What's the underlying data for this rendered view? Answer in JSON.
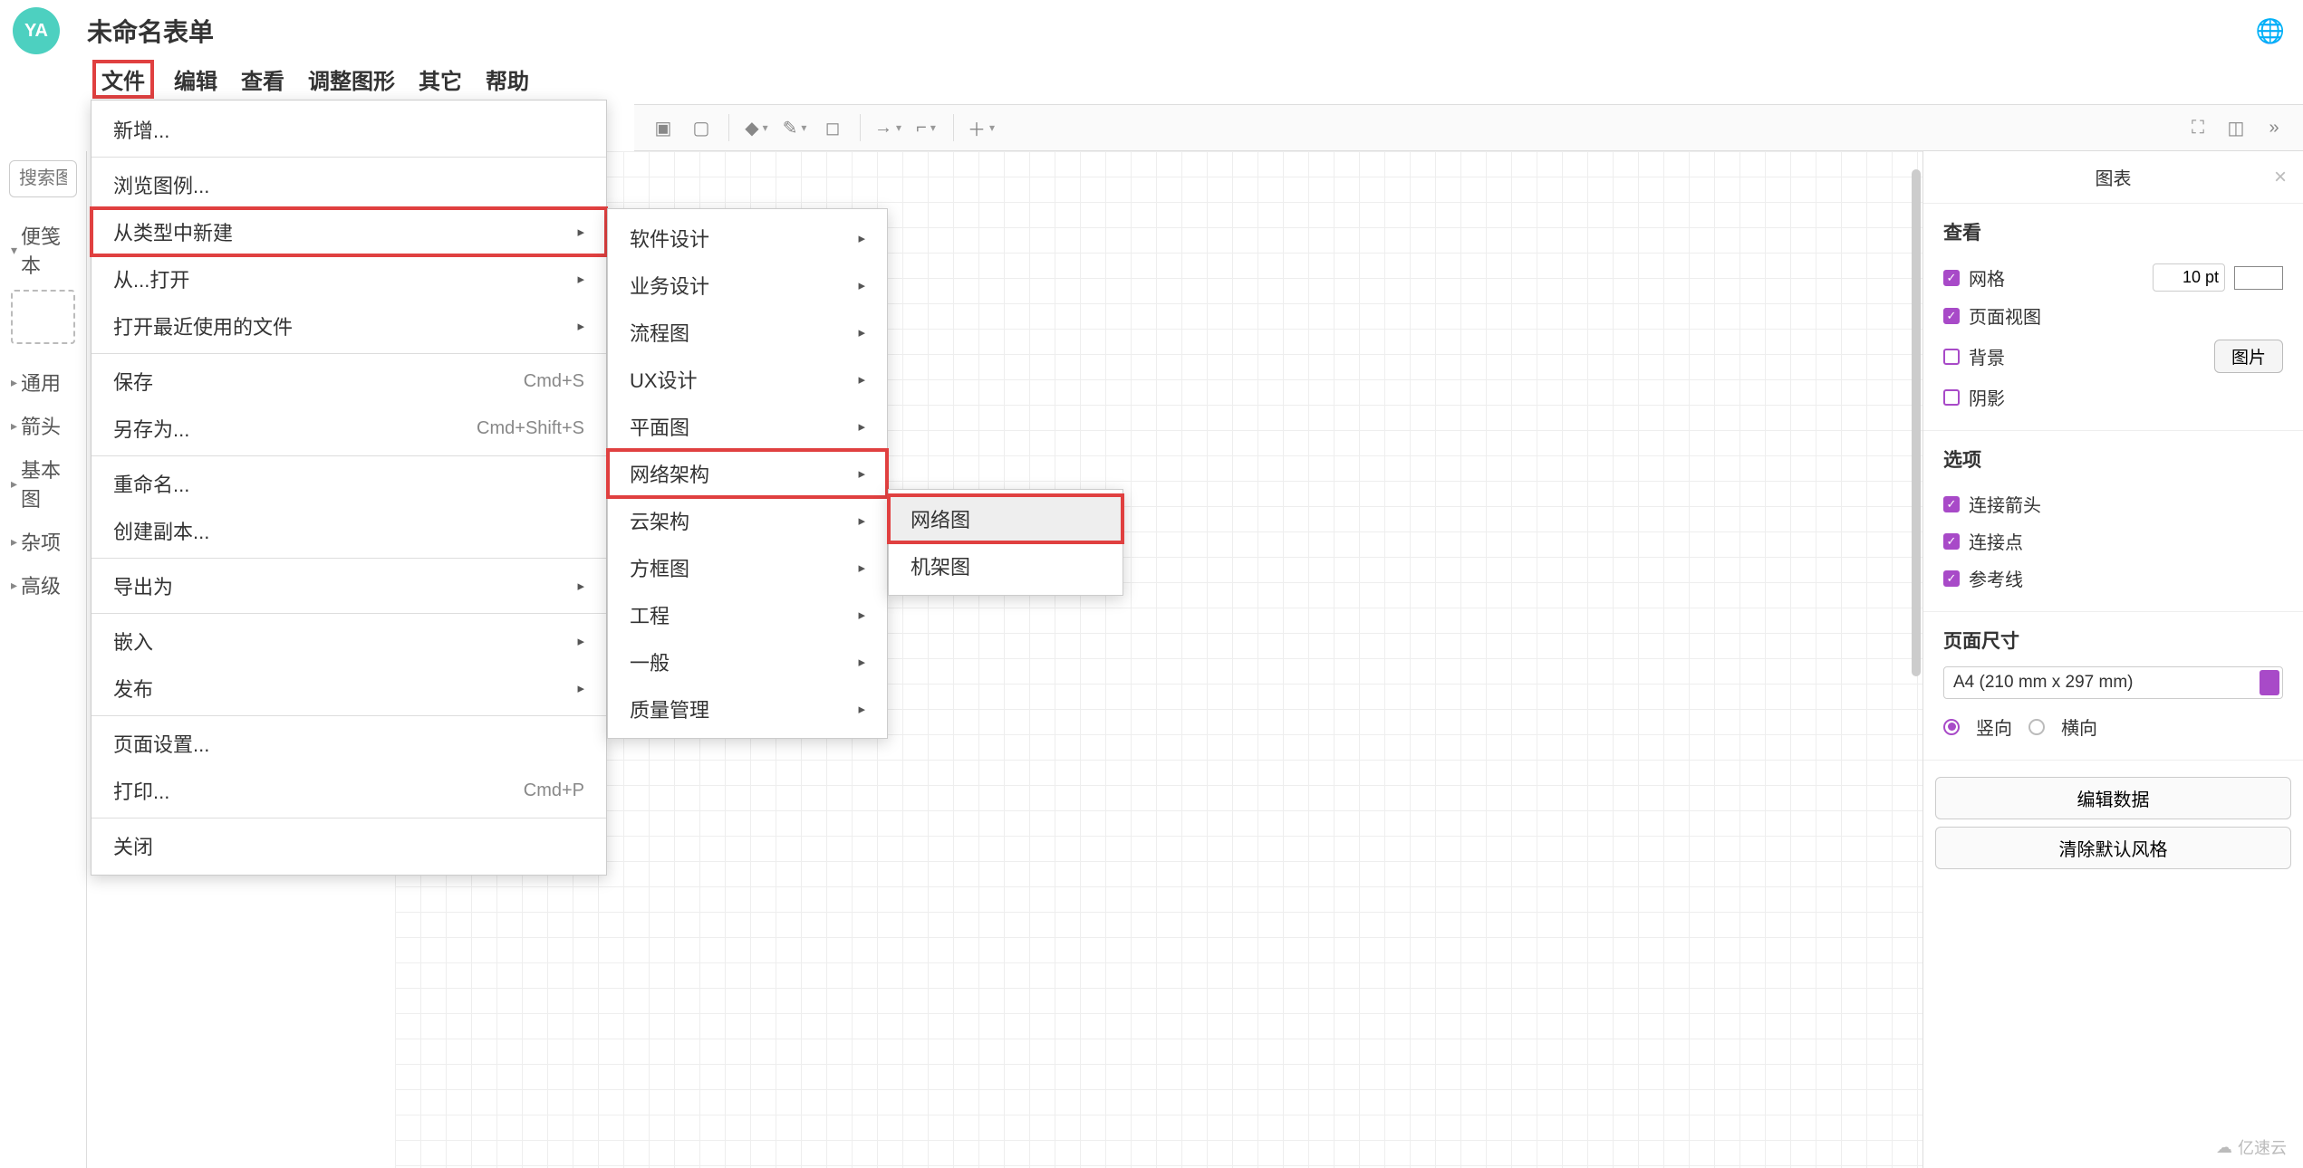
{
  "header": {
    "avatar": "YA",
    "title": "未命名表单"
  },
  "menubar": [
    "文件",
    "编辑",
    "查看",
    "调整图形",
    "其它",
    "帮助"
  ],
  "sidebar": {
    "search_placeholder": "搜索图",
    "sections": [
      "便笺本",
      "通用",
      "箭头",
      "基本图",
      "杂项",
      "高级"
    ]
  },
  "file_menu": {
    "items": [
      {
        "label": "新增...",
        "type": "item"
      },
      {
        "type": "sep"
      },
      {
        "label": "浏览图例...",
        "type": "item"
      },
      {
        "label": "从类型中新建",
        "type": "sub",
        "hl": true
      },
      {
        "label": "从...打开",
        "type": "sub"
      },
      {
        "label": "打开最近使用的文件",
        "type": "sub"
      },
      {
        "type": "sep"
      },
      {
        "label": "保存",
        "shortcut": "Cmd+S",
        "type": "item"
      },
      {
        "label": "另存为...",
        "shortcut": "Cmd+Shift+S",
        "type": "item"
      },
      {
        "type": "sep"
      },
      {
        "label": "重命名...",
        "type": "item"
      },
      {
        "label": "创建副本...",
        "type": "item"
      },
      {
        "type": "sep"
      },
      {
        "label": "导出为",
        "type": "sub"
      },
      {
        "type": "sep"
      },
      {
        "label": "嵌入",
        "type": "sub"
      },
      {
        "label": "发布",
        "type": "sub"
      },
      {
        "type": "sep"
      },
      {
        "label": "页面设置...",
        "type": "item"
      },
      {
        "label": "打印...",
        "shortcut": "Cmd+P",
        "type": "item"
      },
      {
        "type": "sep"
      },
      {
        "label": "关闭",
        "type": "item"
      }
    ]
  },
  "submenu1": {
    "items": [
      {
        "label": "软件设计"
      },
      {
        "label": "业务设计"
      },
      {
        "label": "流程图"
      },
      {
        "label": "UX设计"
      },
      {
        "label": "平面图"
      },
      {
        "label": "网络架构",
        "hl": true
      },
      {
        "label": "云架构"
      },
      {
        "label": "方框图"
      },
      {
        "label": "工程"
      },
      {
        "label": "一般"
      },
      {
        "label": "质量管理"
      }
    ]
  },
  "submenu2": {
    "items": [
      {
        "label": "网络图",
        "hover": true,
        "hl": true
      },
      {
        "label": "机架图"
      }
    ]
  },
  "panel": {
    "tab": "图表",
    "view_h": "查看",
    "grid": "网格",
    "grid_val": "10 pt",
    "page_view": "页面视图",
    "background": "背景",
    "image_btn": "图片",
    "shadow": "阴影",
    "options_h": "选项",
    "conn_arrows": "连接箭头",
    "conn_points": "连接点",
    "guides": "参考线",
    "page_size_h": "页面尺寸",
    "page_size_val": "A4 (210 mm x 297 mm)",
    "portrait": "竖向",
    "landscape": "横向",
    "edit_data": "编辑数据",
    "clear_style": "清除默认风格"
  },
  "watermark": "亿速云"
}
